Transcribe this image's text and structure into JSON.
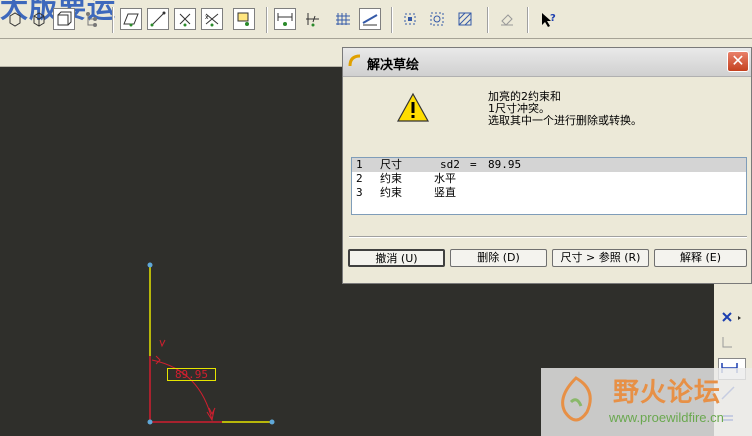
{
  "toolbar": {
    "title_fragment": "大版要运",
    "icons": [
      "box-icon",
      "box-outline-icon",
      "sketch-view-icon",
      "tree-icon",
      "plane-icon",
      "line-icon",
      "coincident-icon",
      "intersect-icon",
      "point-icon",
      "dimension-icon",
      "vertical-dim-icon",
      "grid-icon",
      "chamfer-icon",
      "select-box-icon",
      "select-all-icon",
      "hatch-icon",
      "undo-icon",
      "help-pointer-icon"
    ]
  },
  "dialog": {
    "title": "解决草绘",
    "close_label": "✕",
    "message_line1": "加亮的2约束和",
    "message_line2": "1尺寸冲突。",
    "message_line3": "选取其中一个进行删除或转换。",
    "items": [
      {
        "num": "1",
        "type": "尺寸",
        "name": "sd2",
        "eq": "=",
        "value": "89.95"
      },
      {
        "num": "2",
        "type": "约束",
        "name": "水平",
        "eq": "",
        "value": ""
      },
      {
        "num": "3",
        "type": "约束",
        "name": "竖直",
        "eq": "",
        "value": ""
      }
    ],
    "buttons": {
      "undo": "撤消 (U)",
      "delete": "删除 (D)",
      "dim_to_ref": "尺寸 > 参照 (R)",
      "explain": "解释 (E)"
    }
  },
  "sketch": {
    "dimension_value": "89.95",
    "constraint_mark": "V"
  },
  "watermark": {
    "text": "野火论坛",
    "url": "www.proewildfire.cn"
  },
  "colors": {
    "canvas": "#2f2f2b",
    "dialog_bg": "#ece9d8",
    "sketch_yellow": "#e5e500",
    "sketch_red": "#d01f2f",
    "selection": "#d4d4d4",
    "close_red": "#c4411f"
  }
}
